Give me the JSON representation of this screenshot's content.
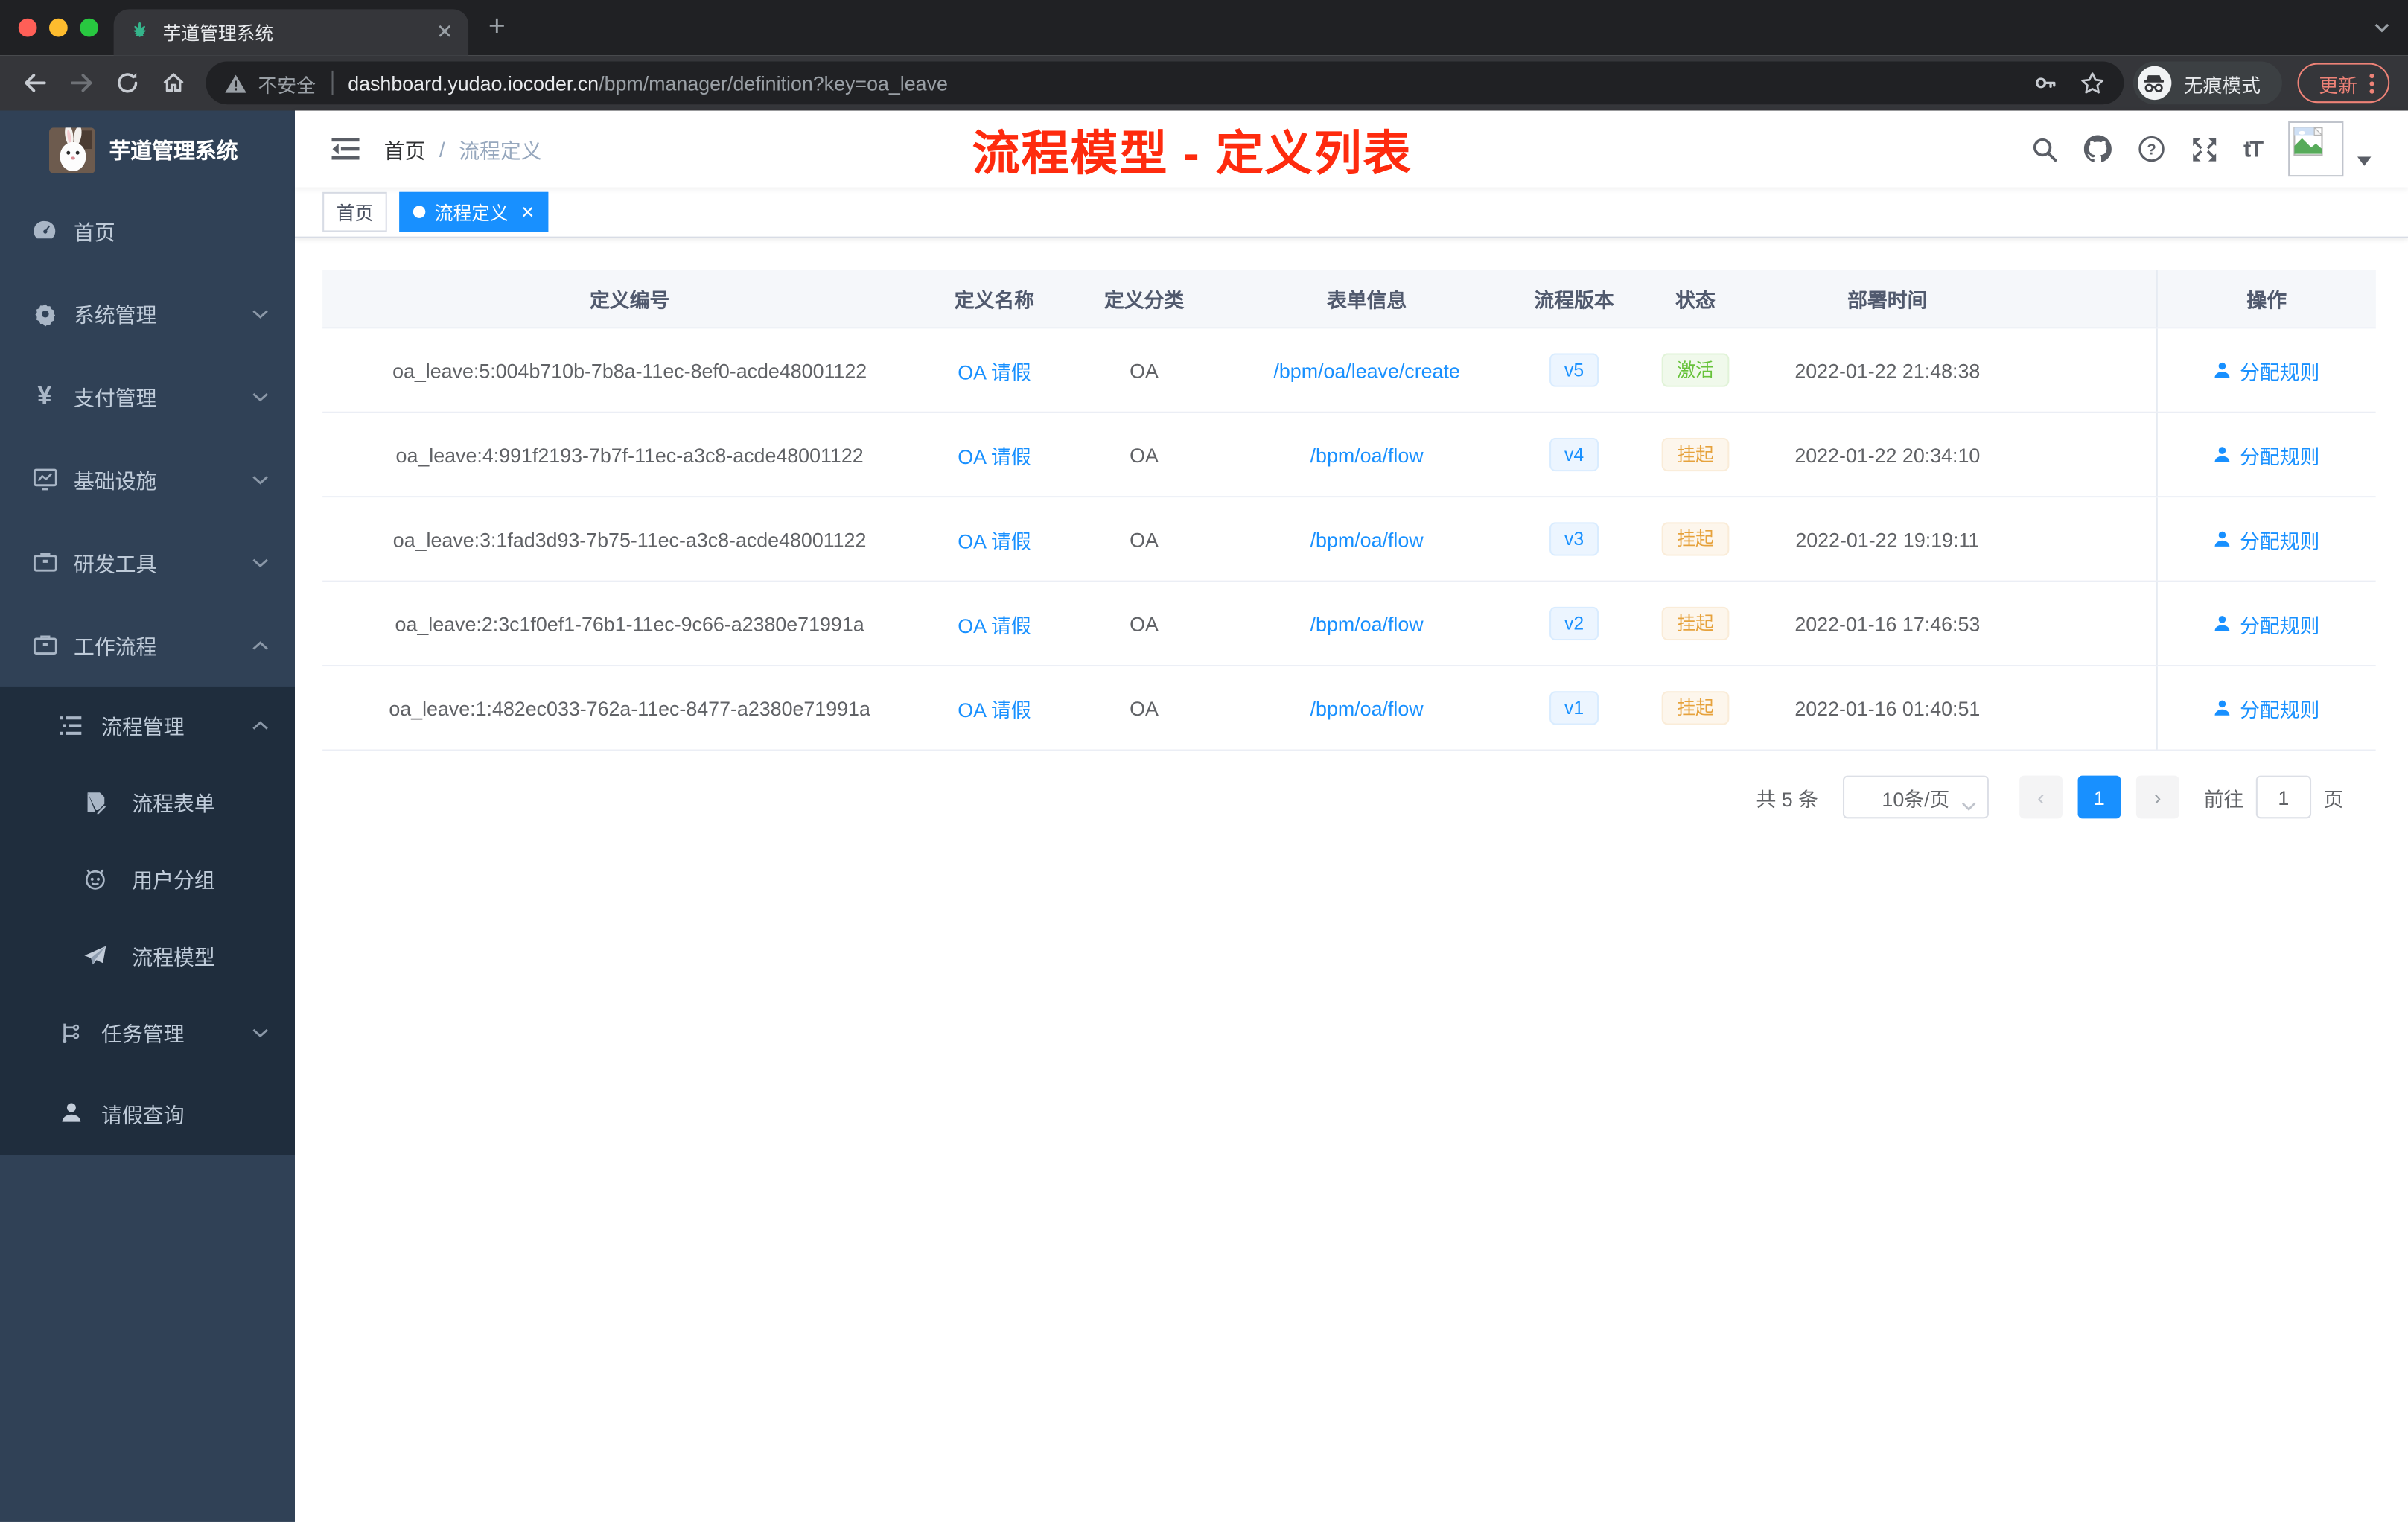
{
  "browser": {
    "tab_title": "芋道管理系统",
    "security_label": "不安全",
    "url_host": "dashboard.yudao.iocoder.cn",
    "url_path": "/bpm/manager/definition?key=oa_leave",
    "incognito_label": "无痕模式",
    "update_label": "更新"
  },
  "sidebar": {
    "logo_title": "芋道管理系统",
    "items": [
      {
        "label": "首页",
        "icon": "dashboard-icon"
      },
      {
        "label": "系统管理",
        "icon": "gear-icon",
        "chevron": "down"
      },
      {
        "label": "支付管理",
        "icon": "yen-icon",
        "chevron": "down"
      },
      {
        "label": "基础设施",
        "icon": "monitor-icon",
        "chevron": "down"
      },
      {
        "label": "研发工具",
        "icon": "briefcase-icon",
        "chevron": "down"
      },
      {
        "label": "工作流程",
        "icon": "briefcase-icon",
        "chevron": "up"
      }
    ],
    "submenu": [
      {
        "label": "流程管理",
        "icon": "list-icon",
        "chevron": "up",
        "level": 2
      },
      {
        "label": "流程表单",
        "icon": "form-icon",
        "level": 3
      },
      {
        "label": "用户分组",
        "icon": "robot-icon",
        "level": 3
      },
      {
        "label": "流程模型",
        "icon": "send-icon",
        "level": 3
      },
      {
        "label": "任务管理",
        "icon": "tree-icon",
        "chevron": "down",
        "level": 2
      },
      {
        "label": "请假查询",
        "icon": "user-icon",
        "level": 2
      }
    ]
  },
  "header": {
    "breadcrumb": [
      "首页",
      "流程定义"
    ],
    "annotation": "流程模型 - 定义列表"
  },
  "tags": [
    {
      "label": "首页",
      "active": false
    },
    {
      "label": "流程定义",
      "active": true
    }
  ],
  "table": {
    "columns": [
      "定义编号",
      "定义名称",
      "定义分类",
      "表单信息",
      "流程版本",
      "状态",
      "部署时间",
      "操作"
    ],
    "rows": [
      {
        "id": "oa_leave:5:004b710b-7b8a-11ec-8ef0-acde48001122",
        "name": "OA 请假",
        "category": "OA",
        "form": "/bpm/oa/leave/create",
        "version": "v5",
        "status": "激活",
        "status_type": "success",
        "deploy_time": "2022-01-22 21:48:38",
        "action_label": "分配规则"
      },
      {
        "id": "oa_leave:4:991f2193-7b7f-11ec-a3c8-acde48001122",
        "name": "OA 请假",
        "category": "OA",
        "form": "/bpm/oa/flow",
        "version": "v4",
        "status": "挂起",
        "status_type": "warning",
        "deploy_time": "2022-01-22 20:34:10",
        "action_label": "分配规则"
      },
      {
        "id": "oa_leave:3:1fad3d93-7b75-11ec-a3c8-acde48001122",
        "name": "OA 请假",
        "category": "OA",
        "form": "/bpm/oa/flow",
        "version": "v3",
        "status": "挂起",
        "status_type": "warning",
        "deploy_time": "2022-01-22 19:19:11",
        "action_label": "分配规则"
      },
      {
        "id": "oa_leave:2:3c1f0ef1-76b1-11ec-9c66-a2380e71991a",
        "name": "OA 请假",
        "category": "OA",
        "form": "/bpm/oa/flow",
        "version": "v2",
        "status": "挂起",
        "status_type": "warning",
        "deploy_time": "2022-01-16 17:46:53",
        "action_label": "分配规则"
      },
      {
        "id": "oa_leave:1:482ec033-762a-11ec-8477-a2380e71991a",
        "name": "OA 请假",
        "category": "OA",
        "form": "/bpm/oa/flow",
        "version": "v1",
        "status": "挂起",
        "status_type": "warning",
        "deploy_time": "2022-01-16 01:40:51",
        "action_label": "分配规则"
      }
    ]
  },
  "pagination": {
    "total_label": "共 5 条",
    "page_size": "10条/页",
    "current_page": "1",
    "goto_label": "前往",
    "goto_value": "1",
    "page_unit": "页"
  },
  "colors": {
    "primary": "#1890ff",
    "success": "#67c23a",
    "warning": "#e6a23c",
    "annotation_red": "#fe2b0e",
    "sidebar_bg": "#304156",
    "submenu_bg": "#1f2d3d",
    "chrome_dark": "#202124",
    "chrome_toolbar": "#35363a"
  },
  "icons": {
    "tab_favicon": "leaf-logo",
    "toolbar": [
      "back-arrow",
      "forward-arrow",
      "reload",
      "home",
      "warning-triangle",
      "key",
      "star"
    ],
    "navbar": [
      "search",
      "github",
      "question",
      "fullscreen",
      "font-size",
      "avatar-placeholder"
    ],
    "row_action": "user"
  }
}
